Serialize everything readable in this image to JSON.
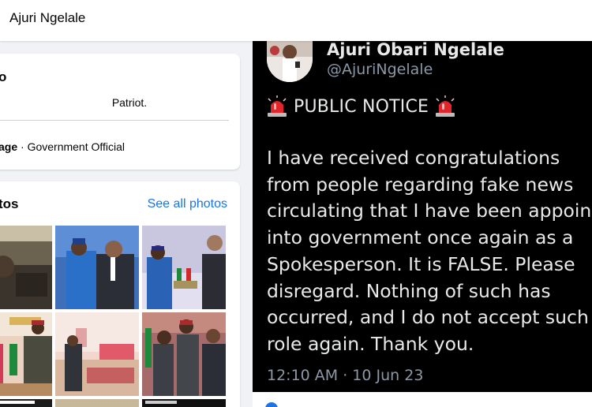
{
  "header": {
    "page_name": "Ajuri Ngelale"
  },
  "intro": {
    "title_fragment": "o",
    "bio": "Patriot.",
    "category_label": "age",
    "category_separator": " · ",
    "category_value": "Government Official"
  },
  "photos": {
    "title_fragment": "tos",
    "see_all_label": "See all photos"
  },
  "tweet": {
    "display_name": "Ajuri Obari Ngelale",
    "handle": "@AjuriNgelale",
    "notice": "PUBLIC NOTICE",
    "body_lines": [
      "I have received congratulations",
      "from people regarding fake news",
      "circulating that I have been appoint",
      "into government once again as a",
      "Spokesperson. It is FALSE. Please",
      "disregard. Nothing of such has",
      "occurred, and I do not accept such",
      "role again. Thank you."
    ],
    "timestamp": "12:10 AM · 10 Jun 23"
  },
  "icons": [
    "siren-icon",
    "like-reaction-icon"
  ],
  "colors": {
    "link": "#1b74e4",
    "tweet_bg": "#000000",
    "page_bg": "#f0f2f5"
  }
}
